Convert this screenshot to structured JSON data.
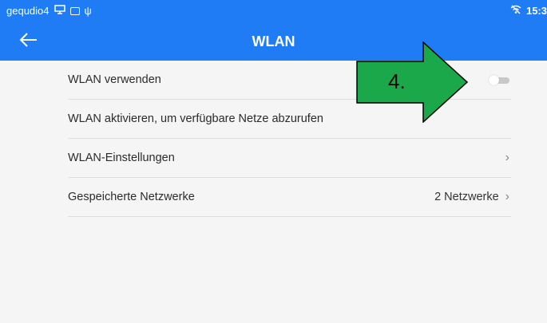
{
  "statusbar": {
    "device_name": "gequdio4",
    "time": "15:3",
    "icons": [
      "cast-icon",
      "image-icon",
      "usb-icon",
      "wifi-off-icon"
    ]
  },
  "header": {
    "title": "WLAN",
    "back_icon": "arrow-left-icon",
    "bg_color": "#1f7cf5"
  },
  "settings": {
    "items": [
      {
        "label": "WLAN verwenden",
        "toggle": "off"
      },
      {
        "label": "WLAN aktivieren, um verfügbare Netze abzurufen"
      },
      {
        "label": "WLAN-Einstellungen",
        "chevron": "›"
      },
      {
        "label": "Gespeicherte Netzwerke",
        "value": "2 Netzwerke",
        "chevron": "›"
      }
    ]
  },
  "annotation": {
    "label": "4.",
    "color": "#1aa84b"
  }
}
